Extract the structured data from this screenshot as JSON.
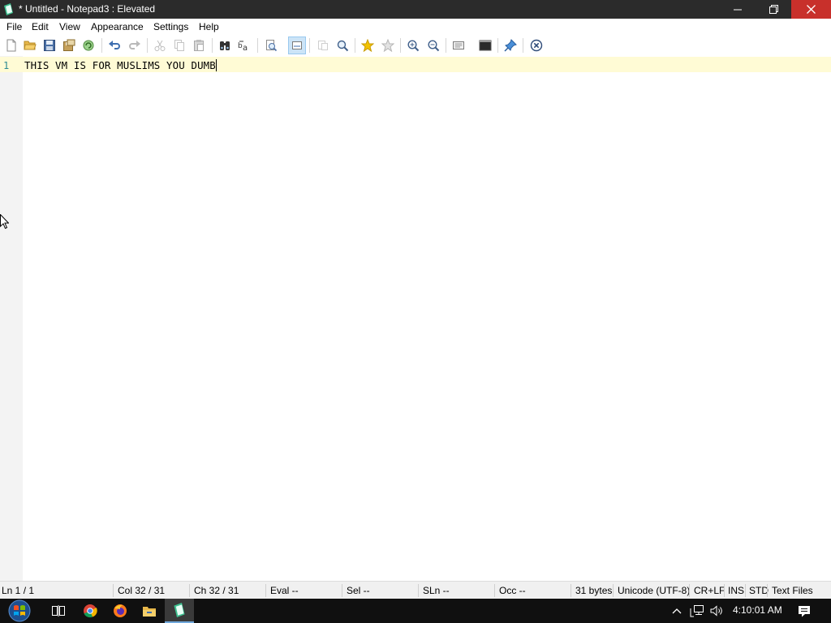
{
  "window": {
    "title": "* Untitled - Notepad3 : Elevated"
  },
  "menu": {
    "items": [
      "File",
      "Edit",
      "View",
      "Appearance",
      "Settings",
      "Help"
    ]
  },
  "editor": {
    "lines": [
      {
        "number": "1",
        "text": "THIS VM IS FOR MUSLIMS YOU DUMB"
      }
    ]
  },
  "status": {
    "ln": "Ln  1 / 1",
    "col": "Col  32 / 31",
    "ch": "Ch  32 / 31",
    "eval": "Eval  --",
    "sel": "Sel  --",
    "sln": "SLn  --",
    "occ": "Occ  --",
    "bytes": "31 bytes",
    "encoding": "Unicode (UTF-8)",
    "eol": "CR+LF",
    "ins": "INS",
    "std": "STD",
    "filetype": "Text Files"
  },
  "taskbar": {
    "clock": "4:10:01 AM"
  },
  "colors": {
    "current_line": "#fffbd5",
    "line_number": "#2b8a93",
    "close_button": "#c8302b"
  },
  "icons": {
    "toolbar": [
      "new-file-icon",
      "open-folder-icon",
      "save-icon",
      "save-as-icon",
      "reload-icon",
      "undo-icon",
      "redo-icon",
      "cut-icon",
      "copy-icon",
      "paste-icon",
      "find-icon",
      "replace-icon",
      "goto-icon",
      "word-wrap-icon",
      "fold-icon",
      "find-next-icon",
      "favorite-icon",
      "add-favorite-icon",
      "zoom-in-icon",
      "zoom-out-icon",
      "settings-icon",
      "terminal-icon",
      "pin-icon",
      "exit-icon"
    ],
    "taskbar": [
      "start-icon",
      "task-view-icon",
      "chrome-icon",
      "firefox-icon",
      "file-explorer-icon",
      "notepad3-icon"
    ]
  }
}
